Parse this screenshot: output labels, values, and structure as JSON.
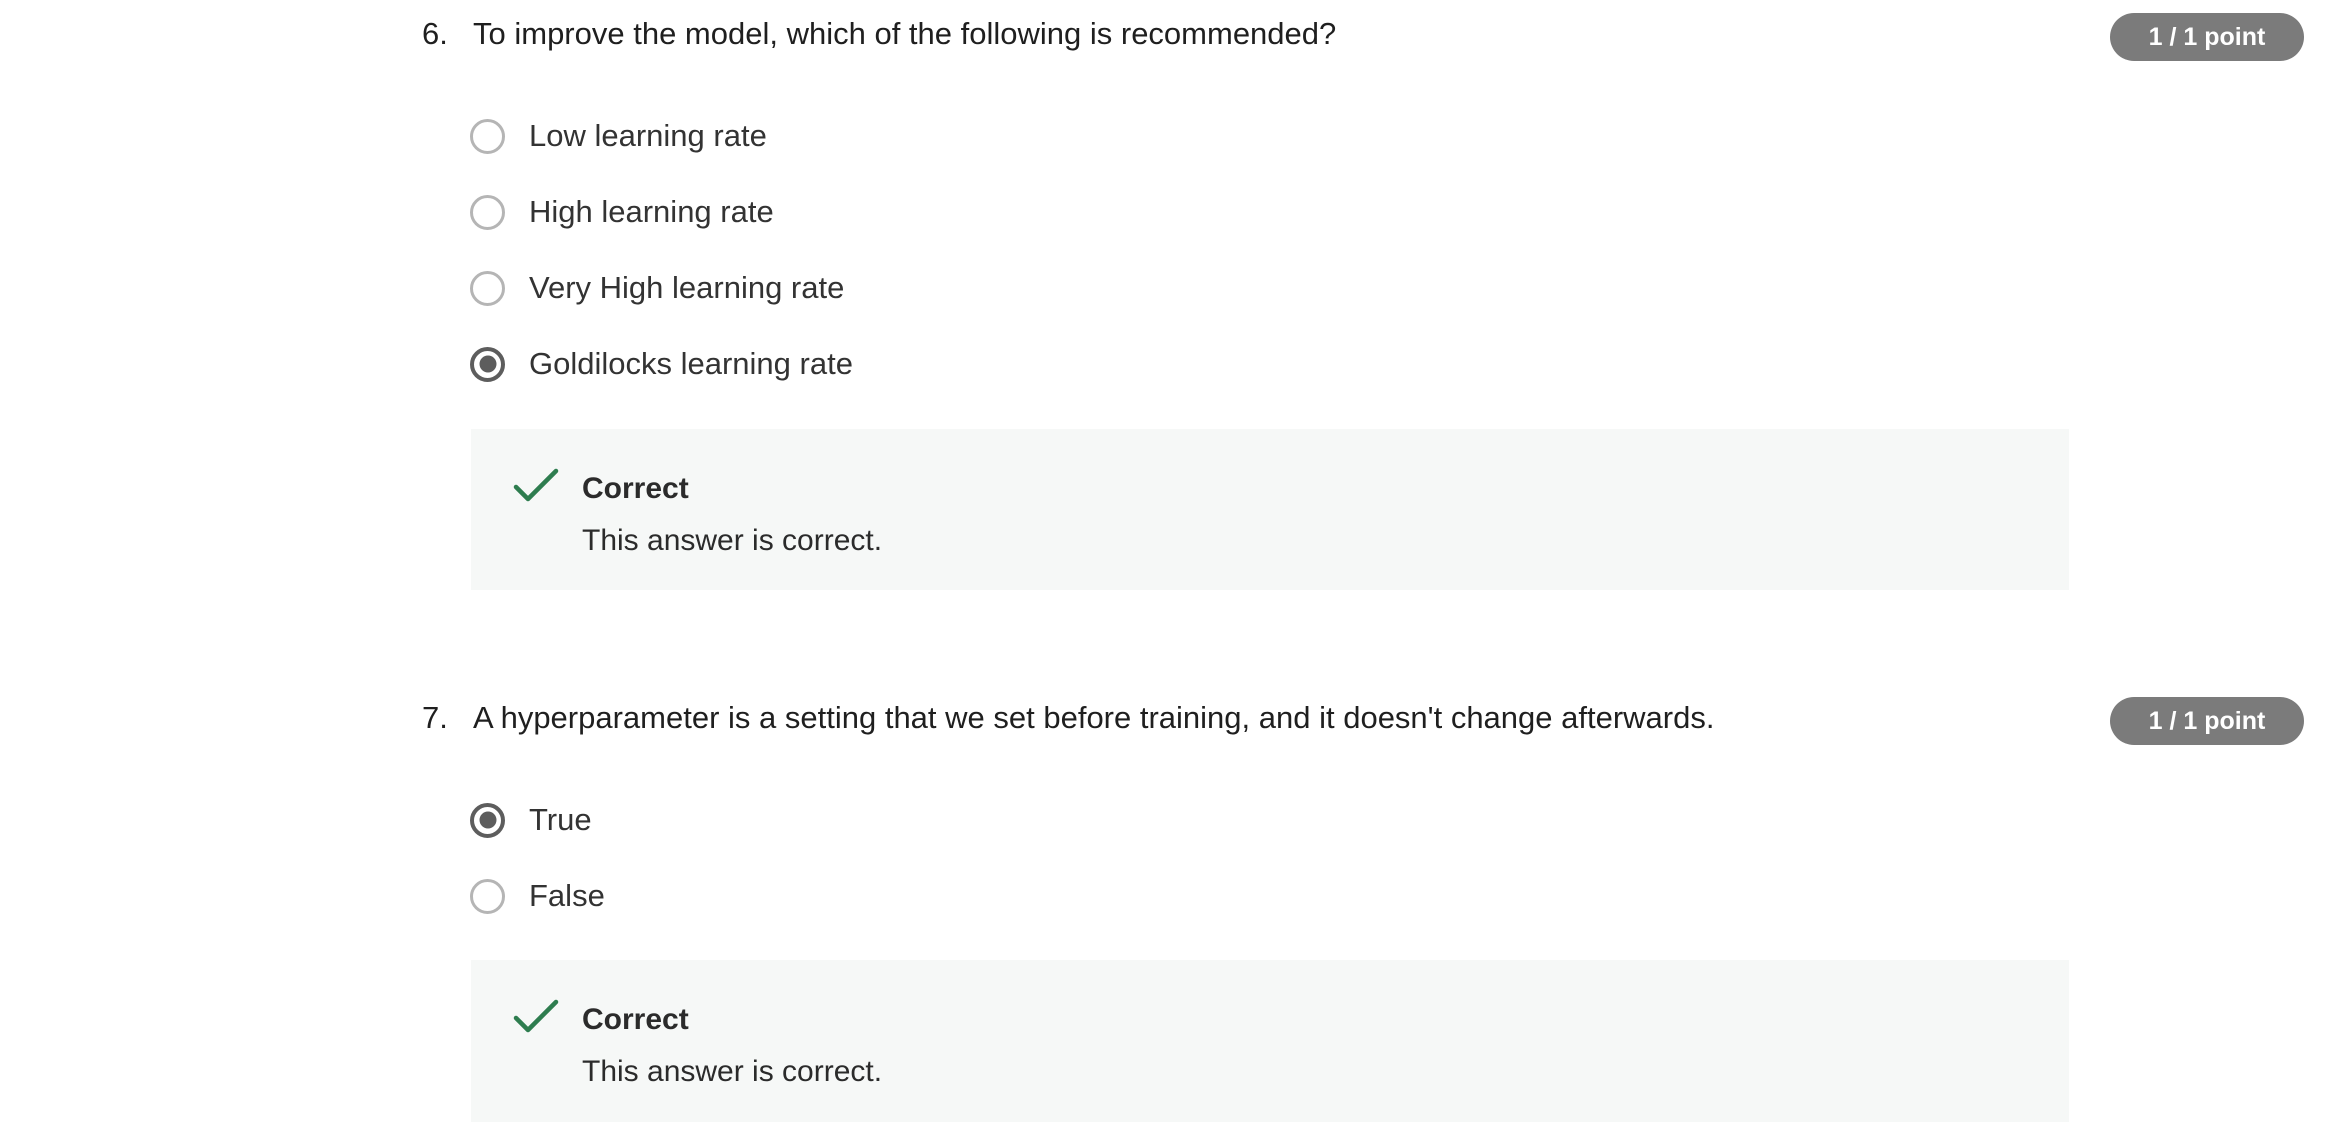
{
  "questions": [
    {
      "number": "6.",
      "text": "To improve the model, which of the following is recommended?",
      "points": "1 / 1 point",
      "options": [
        {
          "label": "Low learning rate",
          "selected": false
        },
        {
          "label": "High learning rate",
          "selected": false
        },
        {
          "label": "Very High learning rate",
          "selected": false
        },
        {
          "label": "Goldilocks learning rate",
          "selected": true
        }
      ],
      "feedback": {
        "title": "Correct",
        "text": "This answer is correct.",
        "icon": "check-icon"
      }
    },
    {
      "number": "7.",
      "text": "A hyperparameter is a setting that we set before training, and it doesn't change afterwards.",
      "points": "1 / 1 point",
      "options": [
        {
          "label": "True",
          "selected": true
        },
        {
          "label": "False",
          "selected": false
        }
      ],
      "feedback": {
        "title": "Correct",
        "text": "This answer is correct.",
        "icon": "check-icon"
      }
    }
  ],
  "colors": {
    "correct_check": "#2e7d4f",
    "badge_bg": "#7b7b7b",
    "feedback_bg": "#f6f8f7"
  }
}
